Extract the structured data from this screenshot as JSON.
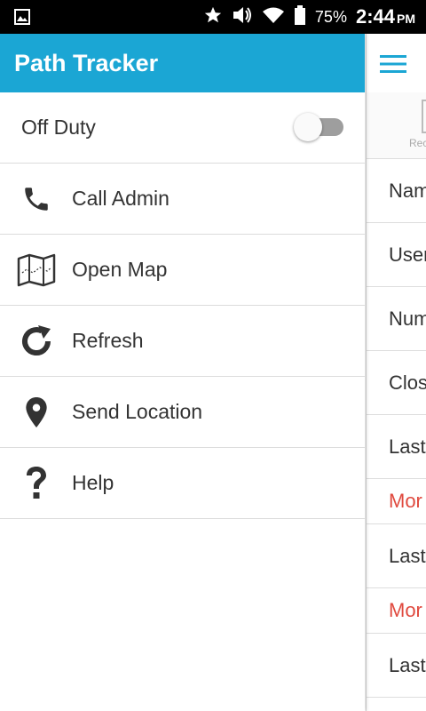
{
  "status_bar": {
    "icons": [
      "gallery-icon",
      "star-icon",
      "volume-icon",
      "wifi-icon",
      "battery-icon"
    ],
    "battery": "75%",
    "time": "2:44",
    "ampm": "PM"
  },
  "app": {
    "title": "Path Tracker",
    "accent_color": "#1ba6d4"
  },
  "drawer": {
    "off_duty": {
      "label": "Off Duty",
      "toggle_on": false
    },
    "items": [
      {
        "label": "Call Admin",
        "icon": "phone-icon"
      },
      {
        "label": "Open Map",
        "icon": "map-icon"
      },
      {
        "label": "Refresh",
        "icon": "refresh-icon"
      },
      {
        "label": "Send Location",
        "icon": "location-pin-icon"
      },
      {
        "label": "Help",
        "icon": "help-icon"
      }
    ]
  },
  "background_screen": {
    "tab_label": "Rec",
    "rows": [
      "Nam",
      "User",
      "Num",
      "Clos",
      "Last",
      "Mor",
      "Last",
      "Mor",
      "Last"
    ],
    "highlight_color": "#e04a3f"
  }
}
